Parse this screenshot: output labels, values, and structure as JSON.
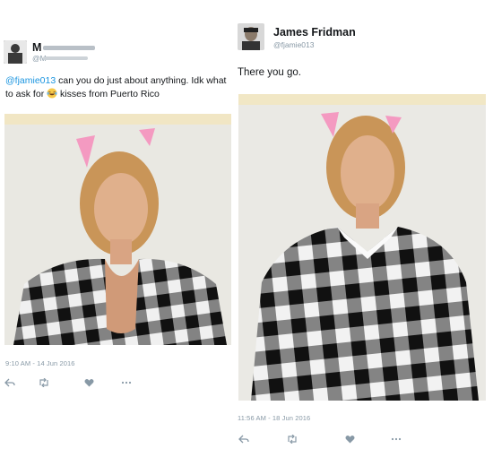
{
  "left_tweet": {
    "author_name": "M",
    "author_handle": "@M",
    "mention": "@fjamie013",
    "text_part1": " can you do just about anything. Idk what to ask for ",
    "emoji_name": "laughing-tears-emoji",
    "text_part2": " kisses from Puerto Rico",
    "timestamp": "9:10 AM - 14 Jun 2016"
  },
  "right_tweet": {
    "author_name": "James Fridman",
    "author_handle": "@fjamie013",
    "text": "There you go.",
    "timestamp": "11:56 AM - 18 Jun 2016"
  },
  "actions": [
    "reply-icon",
    "retweet-icon",
    "like-icon",
    "more-icon"
  ],
  "colors": {
    "link": "#1b95e0",
    "muted": "#8899a6",
    "shirt_dark": "#1a1a1a",
    "shirt_light": "#f2f2f2",
    "party_hat": "#f49ac1",
    "hair": "#c99558"
  }
}
